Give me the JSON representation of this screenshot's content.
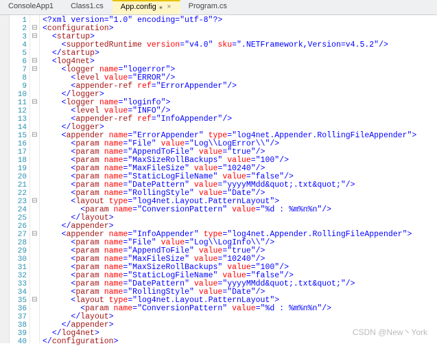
{
  "tabs": [
    {
      "label": "ConsoleApp1",
      "active": false
    },
    {
      "label": "Class1.cs",
      "active": false
    },
    {
      "label": "App.config",
      "active": true
    },
    {
      "label": "Program.cs",
      "active": false
    }
  ],
  "watermark": "CSDN @New丶York",
  "file_language": "XML",
  "code_lines": [
    {
      "n": 1,
      "fold": "",
      "indent": 0,
      "raw": "<?xml version=\"1.0\" encoding=\"utf-8\"?>",
      "type": "pi"
    },
    {
      "n": 2,
      "fold": "-",
      "indent": 0,
      "tag": "configuration",
      "attrs": [],
      "self": false,
      "close": false
    },
    {
      "n": 3,
      "fold": "-",
      "indent": 1,
      "tag": "startup",
      "attrs": [],
      "self": false,
      "close": false
    },
    {
      "n": 4,
      "fold": "",
      "indent": 2,
      "tag": "supportedRuntime",
      "attrs": [
        [
          "version",
          "v4.0"
        ],
        [
          "sku",
          ".NETFramework,Version=v4.5.2"
        ]
      ],
      "self": true
    },
    {
      "n": 5,
      "fold": "",
      "indent": 1,
      "tag": "startup",
      "close": true
    },
    {
      "n": 6,
      "fold": "-",
      "indent": 1,
      "tag": "log4net",
      "attrs": [],
      "self": false,
      "close": false
    },
    {
      "n": 7,
      "fold": "-",
      "indent": 2,
      "tag": "logger",
      "attrs": [
        [
          "name",
          "logerror"
        ]
      ],
      "self": false,
      "close": false
    },
    {
      "n": 8,
      "fold": "",
      "indent": 3,
      "tag": "level",
      "attrs": [
        [
          "value",
          "ERROR"
        ]
      ],
      "self": true
    },
    {
      "n": 9,
      "fold": "",
      "indent": 3,
      "tag": "appender-ref",
      "attrs": [
        [
          "ref",
          "ErrorAppender"
        ]
      ],
      "self": true
    },
    {
      "n": 10,
      "fold": "",
      "indent": 2,
      "tag": "logger",
      "close": true
    },
    {
      "n": 11,
      "fold": "-",
      "indent": 2,
      "tag": "logger",
      "attrs": [
        [
          "name",
          "loginfo"
        ]
      ],
      "self": false,
      "close": false
    },
    {
      "n": 12,
      "fold": "",
      "indent": 3,
      "tag": "level",
      "attrs": [
        [
          "value",
          "INFO"
        ]
      ],
      "self": true
    },
    {
      "n": 13,
      "fold": "",
      "indent": 3,
      "tag": "appender-ref",
      "attrs": [
        [
          "ref",
          "InfoAppender"
        ]
      ],
      "self": true
    },
    {
      "n": 14,
      "fold": "",
      "indent": 2,
      "tag": "logger",
      "close": true
    },
    {
      "n": 15,
      "fold": "-",
      "indent": 2,
      "tag": "appender",
      "attrs": [
        [
          "name",
          "ErrorAppender"
        ],
        [
          "type",
          "log4net.Appender.RollingFileAppender"
        ]
      ],
      "self": false,
      "close": false
    },
    {
      "n": 16,
      "fold": "",
      "indent": 3,
      "tag": "param",
      "attrs": [
        [
          "name",
          "File"
        ],
        [
          "value",
          "Log\\\\LogError\\\\"
        ]
      ],
      "self": true
    },
    {
      "n": 17,
      "fold": "",
      "indent": 3,
      "tag": "param",
      "attrs": [
        [
          "name",
          "AppendToFile"
        ],
        [
          "value",
          "true"
        ]
      ],
      "self": true
    },
    {
      "n": 18,
      "fold": "",
      "indent": 3,
      "tag": "param",
      "attrs": [
        [
          "name",
          "MaxSizeRollBackups"
        ],
        [
          "value",
          "100"
        ]
      ],
      "self": true
    },
    {
      "n": 19,
      "fold": "",
      "indent": 3,
      "tag": "param",
      "attrs": [
        [
          "name",
          "MaxFileSize"
        ],
        [
          "value",
          "10240"
        ]
      ],
      "self": true
    },
    {
      "n": 20,
      "fold": "",
      "indent": 3,
      "tag": "param",
      "attrs": [
        [
          "name",
          "StaticLogFileName"
        ],
        [
          "value",
          "false"
        ]
      ],
      "self": true
    },
    {
      "n": 21,
      "fold": "",
      "indent": 3,
      "tag": "param",
      "attrs": [
        [
          "name",
          "DatePattern"
        ],
        [
          "value",
          "yyyyMMdd&quot;.txt&quot;"
        ]
      ],
      "self": true
    },
    {
      "n": 22,
      "fold": "",
      "indent": 3,
      "tag": "param",
      "attrs": [
        [
          "name",
          "RollingStyle"
        ],
        [
          "value",
          "Date"
        ]
      ],
      "self": true
    },
    {
      "n": 23,
      "fold": "-",
      "indent": 3,
      "tag": "layout",
      "attrs": [
        [
          "type",
          "log4net.Layout.PatternLayout"
        ]
      ],
      "self": false,
      "close": false
    },
    {
      "n": 24,
      "fold": "",
      "indent": 4,
      "tag": "param",
      "attrs": [
        [
          "name",
          "ConversionPattern"
        ],
        [
          "value",
          "%d : %m%n%n"
        ]
      ],
      "self": true
    },
    {
      "n": 25,
      "fold": "",
      "indent": 3,
      "tag": "layout",
      "close": true
    },
    {
      "n": 26,
      "fold": "",
      "indent": 2,
      "tag": "appender",
      "close": true
    },
    {
      "n": 27,
      "fold": "-",
      "indent": 2,
      "tag": "appender",
      "attrs": [
        [
          "name",
          "InfoAppender"
        ],
        [
          "type",
          "log4net.Appender.RollingFileAppender"
        ]
      ],
      "self": false,
      "close": false
    },
    {
      "n": 28,
      "fold": "",
      "indent": 3,
      "tag": "param",
      "attrs": [
        [
          "name",
          "File"
        ],
        [
          "value",
          "Log\\\\LogInfo\\\\"
        ]
      ],
      "self": true
    },
    {
      "n": 29,
      "fold": "",
      "indent": 3,
      "tag": "param",
      "attrs": [
        [
          "name",
          "AppendToFile"
        ],
        [
          "value",
          "true"
        ]
      ],
      "self": true
    },
    {
      "n": 30,
      "fold": "",
      "indent": 3,
      "tag": "param",
      "attrs": [
        [
          "name",
          "MaxFileSize"
        ],
        [
          "value",
          "10240"
        ]
      ],
      "self": true
    },
    {
      "n": 31,
      "fold": "",
      "indent": 3,
      "tag": "param",
      "attrs": [
        [
          "name",
          "MaxSizeRollBackups"
        ],
        [
          "value",
          "100"
        ]
      ],
      "self": true
    },
    {
      "n": 32,
      "fold": "",
      "indent": 3,
      "tag": "param",
      "attrs": [
        [
          "name",
          "StaticLogFileName"
        ],
        [
          "value",
          "false"
        ]
      ],
      "self": true
    },
    {
      "n": 33,
      "fold": "",
      "indent": 3,
      "tag": "param",
      "attrs": [
        [
          "name",
          "DatePattern"
        ],
        [
          "value",
          "yyyyMMdd&quot;.txt&quot;"
        ]
      ],
      "self": true
    },
    {
      "n": 34,
      "fold": "",
      "indent": 3,
      "tag": "param",
      "attrs": [
        [
          "name",
          "RollingStyle"
        ],
        [
          "value",
          "Date"
        ]
      ],
      "self": true
    },
    {
      "n": 35,
      "fold": "-",
      "indent": 3,
      "tag": "layout",
      "attrs": [
        [
          "type",
          "log4net.Layout.PatternLayout"
        ]
      ],
      "self": false,
      "close": false
    },
    {
      "n": 36,
      "fold": "",
      "indent": 4,
      "tag": "param",
      "attrs": [
        [
          "name",
          "ConversionPattern"
        ],
        [
          "value",
          "%d : %m%n%n"
        ]
      ],
      "self": true
    },
    {
      "n": 37,
      "fold": "",
      "indent": 3,
      "tag": "layout",
      "close": true
    },
    {
      "n": 38,
      "fold": "",
      "indent": 2,
      "tag": "appender",
      "close": true
    },
    {
      "n": 39,
      "fold": "",
      "indent": 1,
      "tag": "log4net",
      "close": true
    },
    {
      "n": 40,
      "fold": "",
      "indent": 0,
      "tag": "configuration",
      "close": true
    }
  ]
}
